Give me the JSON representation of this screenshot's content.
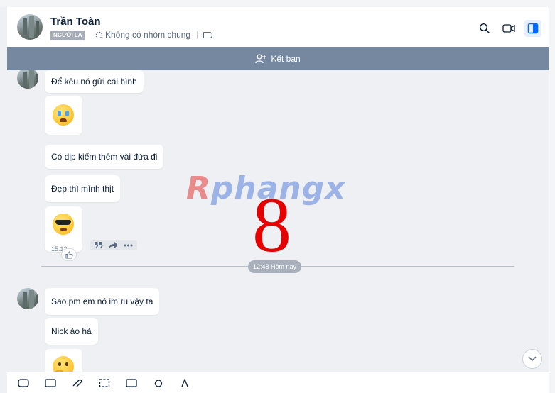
{
  "header": {
    "name": "Trần Toàn",
    "tag": "NGƯỜI LẠ",
    "groups_text": "Không có nhóm chung"
  },
  "friend_bar": {
    "label": "Kết bạn"
  },
  "messages": [
    {
      "text": "Để kêu nó gửi cái hình"
    },
    {
      "text": "Có dịp kiếm thêm vài đứa đi"
    },
    {
      "text": "Đẹp thì mình thịt"
    },
    {
      "text": "Sao pm em nó im ru vậy ta"
    },
    {
      "text": "Nick ảo hả"
    }
  ],
  "message_time": "15:12",
  "date_separator": "12:48 Hôm nay",
  "watermark": {
    "brand": "Rphangx",
    "number": "8"
  },
  "colors": {
    "friend_bar": "#7688a0",
    "chat_bg": "#eef0f3",
    "accent": "#0068ff",
    "overlay_number": "#e60000"
  }
}
